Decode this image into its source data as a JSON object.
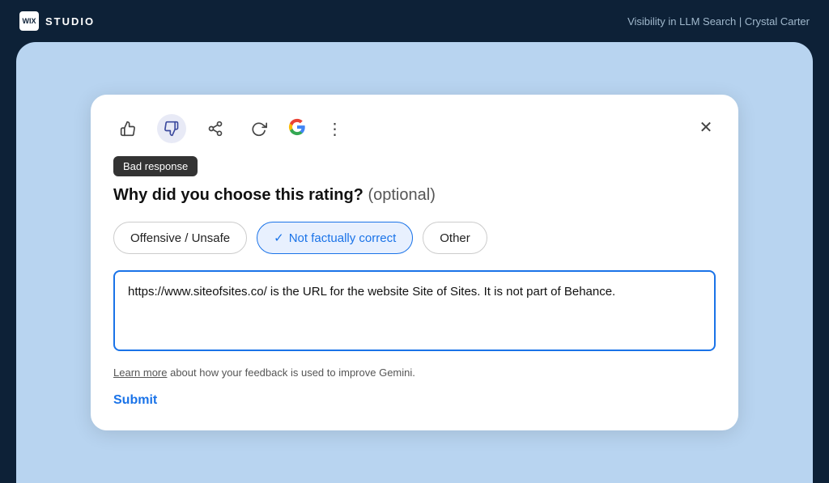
{
  "header": {
    "logo_text": "WIX",
    "brand_text": "STUDIO",
    "subtitle": "Visibility in LLM Search | Crystal Carter"
  },
  "dialog": {
    "icons": {
      "thumbup": "👍",
      "thumbdown": "👎",
      "share": "⤴",
      "refresh": "↻"
    },
    "badge_label": "Bad response",
    "question": "Why did you choose this rating?",
    "optional_label": "(optional)",
    "close_label": "✕",
    "options": [
      {
        "id": "offensive",
        "label": "Offensive / Unsafe",
        "selected": false
      },
      {
        "id": "notfactual",
        "label": "Not factually correct",
        "selected": true
      },
      {
        "id": "other",
        "label": "Other",
        "selected": false
      }
    ],
    "textarea_value": "https://www.siteofsites.co/ is the URL for the website Site of Sites. It is not part of Behance.",
    "learn_more_link": "Learn more",
    "learn_more_text": " about how your feedback is used to improve Gemini.",
    "submit_label": "Submit"
  }
}
